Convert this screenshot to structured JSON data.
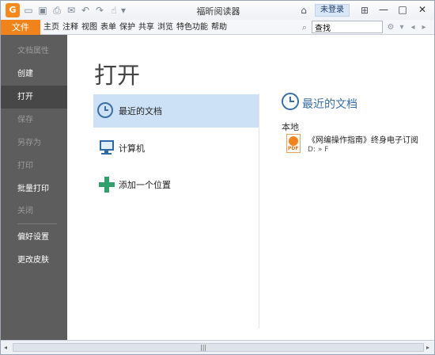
{
  "window": {
    "title": "福昕阅读器",
    "login_label": "未登录",
    "controls": {
      "minimize": "—",
      "maximize": "□",
      "close": "✕"
    },
    "quick_access_icons": [
      "app-logo-icon",
      "open-folder-icon",
      "save-icon",
      "print-icon",
      "email-icon",
      "undo-icon",
      "redo-icon",
      "hand-tool-icon"
    ]
  },
  "ribbon": {
    "file_tab": "文件",
    "menu_items": [
      "主页",
      "注释",
      "视图",
      "表单",
      "保护",
      "共享",
      "浏览",
      "特色功能",
      "帮助"
    ],
    "search": {
      "value": "查找",
      "placeholder": "查找"
    }
  },
  "sidebar": {
    "items": [
      {
        "label": "文档属性",
        "enabled": false
      },
      {
        "label": "创建",
        "enabled": true
      },
      {
        "label": "打开",
        "enabled": true,
        "active": true
      },
      {
        "label": "保存",
        "enabled": false
      },
      {
        "label": "另存为",
        "enabled": false
      },
      {
        "label": "打印",
        "enabled": false
      },
      {
        "label": "批量打印",
        "enabled": true
      },
      {
        "label": "关闭",
        "enabled": false
      },
      {
        "label": "偏好设置",
        "enabled": true
      },
      {
        "label": "更改皮肤",
        "enabled": true
      }
    ]
  },
  "main": {
    "title": "打开",
    "locations": [
      {
        "label": "最近的文档",
        "icon": "clock-icon",
        "selected": true
      },
      {
        "label": "计算机",
        "icon": "computer-icon",
        "selected": false
      },
      {
        "label": "添加一个位置",
        "icon": "plus-icon",
        "selected": false
      }
    ],
    "recent": {
      "heading": "最近的文档",
      "section": "本地",
      "documents": [
        {
          "name": "《网编操作指南》终身电子订阅",
          "path": "D: » F",
          "icon": "pdf-icon"
        }
      ]
    }
  },
  "colors": {
    "accent_orange": "#f0831c",
    "sidebar_bg": "#5d5d5d",
    "sidebar_active": "#474747",
    "selection_blue": "#cde1f6",
    "heading_blue": "#3a6ea5",
    "add_green": "#33a06c"
  }
}
